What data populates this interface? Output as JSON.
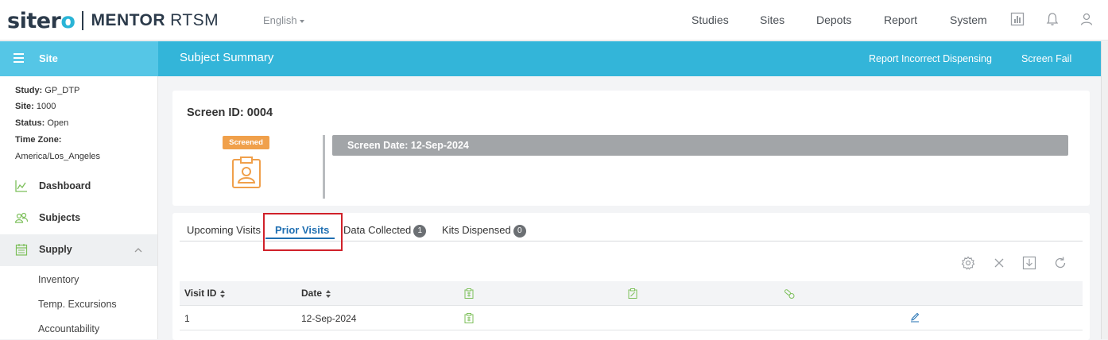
{
  "app": {
    "brand_pre": "siter",
    "brand_o": "o",
    "brand_mentor": "MENTOR",
    "brand_rtsm": "RTSM",
    "language": "English"
  },
  "topnav": [
    "Studies",
    "Sites",
    "Depots",
    "Report",
    "System"
  ],
  "sidebar": {
    "header": "Site",
    "info": {
      "study_label": "Study:",
      "study_value": "GP_DTP",
      "site_label": "Site:",
      "site_value": "1000",
      "status_label": "Status:",
      "status_value": "Open",
      "tz_label": "Time Zone:",
      "tz_value": "America/Los_Angeles"
    },
    "items": [
      {
        "label": "Dashboard",
        "icon": "line-chart-icon"
      },
      {
        "label": "Subjects",
        "icon": "users-icon"
      },
      {
        "label": "Supply",
        "icon": "calendar-icon"
      }
    ],
    "subitems": [
      "Inventory",
      "Temp. Excursions",
      "Accountability"
    ]
  },
  "header": {
    "title": "Subject Summary",
    "actions": [
      "Report Incorrect Dispensing",
      "Screen Fail"
    ]
  },
  "subject": {
    "screen_id": "Screen ID: 0004",
    "status_badge": "Screened",
    "screen_date": "Screen Date: 12-Sep-2024"
  },
  "tabs": {
    "upcoming": "Upcoming Visits",
    "prior": "Prior Visits",
    "data_collected": "Data Collected",
    "data_collected_count": "1",
    "kits_dispensed": "Kits Dispensed",
    "kits_dispensed_count": "0"
  },
  "table": {
    "columns": [
      "Visit ID",
      "Date"
    ],
    "rows": [
      {
        "visit_id": "1",
        "date": "12-Sep-2024"
      }
    ]
  },
  "colors": {
    "header_blue": "#33b5d9",
    "side_header_blue": "#55c6e6",
    "badge_orange": "#f0a04b",
    "highlight_red": "#d0212a",
    "tab_blue": "#1f6fb2"
  }
}
